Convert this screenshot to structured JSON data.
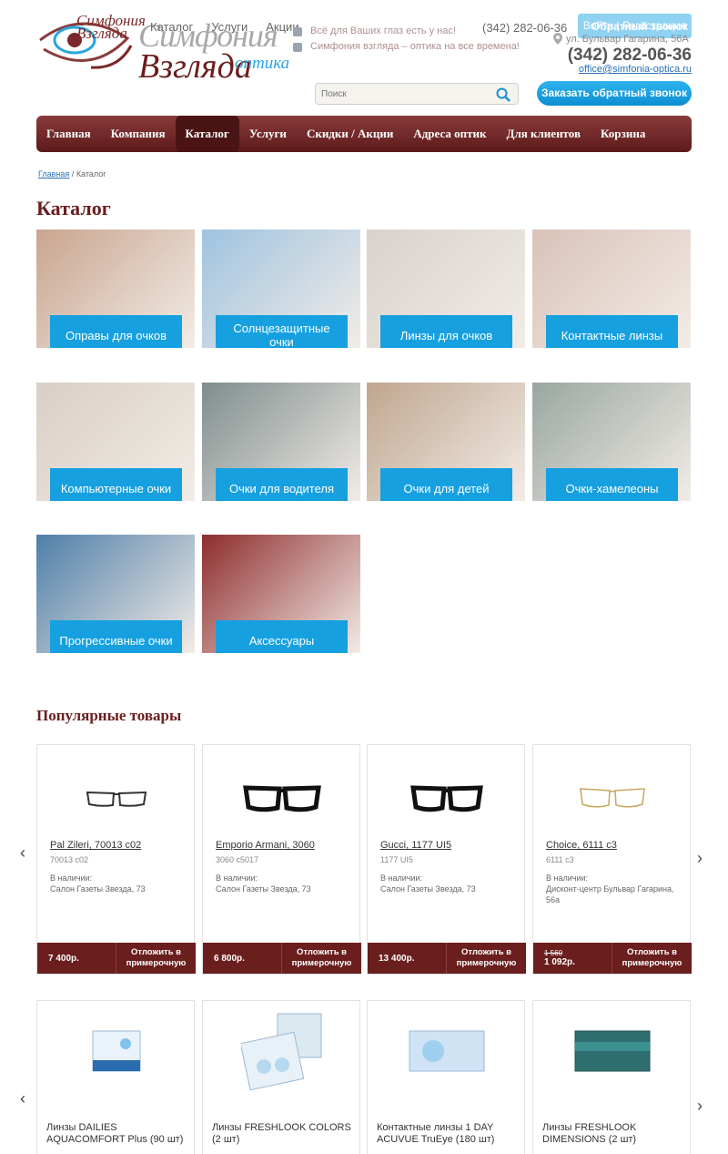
{
  "header": {
    "logo": {
      "line1": "Симфония",
      "line2": "Взгляда",
      "small1": "Симфония",
      "small2": "Взгляда",
      "optika": "оптика"
    },
    "topnav": [
      "Каталог",
      "Услуги",
      "Акции"
    ],
    "promo": [
      "Всё для Ваших глаз есть у нас!",
      "Симфония взгляда – оптика на все времена!"
    ],
    "phone_top": "(342) 282-06-36",
    "login_label": "Войти | Регистрация",
    "callback_overlay": "Обратный звонок",
    "address": "ул. Бульвар Гагарина, 56А",
    "phone_big": "(342) 282-06-36",
    "email": "office@simfonia-optica.ru",
    "search_placeholder": "Поиск",
    "callback_button": "Заказать обратный звонок"
  },
  "mainnav": [
    "Главная",
    "Компания",
    "Каталог",
    "Услуги",
    "Скидки / Акции",
    "Адреса оптик",
    "Для клиентов",
    "Корзина"
  ],
  "breadcrumb": {
    "home": "Главная",
    "sep": "/",
    "current": "Каталог"
  },
  "page_title": "Каталог",
  "catalog": [
    {
      "label": "Оправы для очков",
      "bg": "#c9a58f"
    },
    {
      "label": "Солнцезащитные очки",
      "bg": "#9fc3e0"
    },
    {
      "label": "Линзы для очков",
      "bg": "#d8d2cc"
    },
    {
      "label": "Контактные линзы",
      "bg": "#d9c2b8"
    },
    {
      "label": "Компьютерные очки",
      "bg": "#d8cfc6"
    },
    {
      "label": "Очки для водителя",
      "bg": "#7f8d8d"
    },
    {
      "label": "Очки для детей",
      "bg": "#c0a68f"
    },
    {
      "label": "Очки-хамелеоны",
      "bg": "#9aa6a0"
    },
    {
      "label": "Прогрессивные очки",
      "bg": "#4f7fa8"
    },
    {
      "label": "Аксессуары",
      "bg": "#8e2d2d"
    }
  ],
  "popular_title": "Популярные товары",
  "products": [
    {
      "name": "Pal Zileri, 70013 c02",
      "code": "70013 c02",
      "stock_label": "В наличии:",
      "stock": "Салон Газеты Звезда, 73",
      "price": "7 400р.",
      "old_price": "",
      "reserve": "Отложить в примерочную"
    },
    {
      "name": "Emporio Armani, 3060",
      "code": "3060 c5017",
      "stock_label": "В наличии:",
      "stock": "Салон Газеты Звезда, 73",
      "price": "6 800р.",
      "old_price": "",
      "reserve": "Отложить в примерочную"
    },
    {
      "name": "Gucci, 1177 UI5",
      "code": "1177 UI5",
      "stock_label": "В наличии:",
      "stock": "Салон Газеты Звезда, 73",
      "price": "13 400р.",
      "old_price": "",
      "reserve": "Отложить в примерочную"
    },
    {
      "name": "Choice, 6111 c3",
      "code": "6111 c3",
      "stock_label": "В наличии:",
      "stock": "Дисконт-центр Бульвар Гагарина, 56а",
      "price": "1 092р.",
      "old_price": "1 560",
      "reserve": "Отложить в примерочную"
    }
  ],
  "lenses": [
    {
      "name": "Линзы DAILIES AQUACOMFORT Plus (90 шт)"
    },
    {
      "name": "Линзы FRESHLOOK COLORS (2 шт)"
    },
    {
      "name": "Контактные линзы 1 DAY ACUVUE TruEye (180 шт)"
    },
    {
      "name": "Линзы FRESHLOOK DIMENSIONS (2 шт)"
    }
  ],
  "arrows": {
    "prev": "‹",
    "next": "›"
  }
}
